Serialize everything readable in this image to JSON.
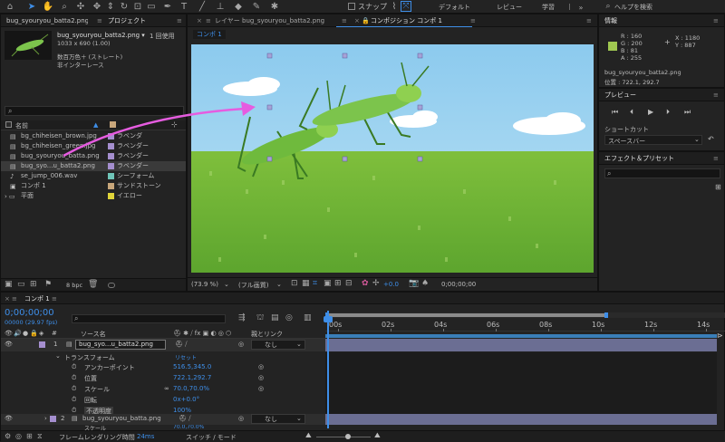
{
  "toolbar": {
    "workspace_link_label": "スナップ",
    "workspaces": [
      "デフォルト",
      "レビュー",
      "学習"
    ],
    "search_placeholder": "ヘルプを検索"
  },
  "project_panel": {
    "left_tab": "bug_syouryou_batta2.png",
    "tab_label": "プロジェクト",
    "preview_name": "bug_syouryou_batta2.png ▾",
    "usage": "1 回使用",
    "dims": "1033 x 690 (1.00)",
    "color_info": "数百万色＋ (ストレート)",
    "interlace": "非インターレース",
    "search_placeholder": "",
    "col_name": "名前",
    "items": [
      {
        "name": "bg_chiheisen_brown.jpg",
        "label": "ラベンダ",
        "color": "#a58fcf"
      },
      {
        "name": "bg_chiheisen_green.jpg",
        "label": "ラベンダー",
        "color": "#a58fcf"
      },
      {
        "name": "bug_syouryou_batta.png",
        "label": "ラベンダー",
        "color": "#a58fcf"
      },
      {
        "name": "bug_syo...u_batta2.png",
        "label": "ラベンダー",
        "color": "#a58fcf"
      },
      {
        "name": "se_jump_006.wav",
        "label": "シーフォーム",
        "color": "#6fc5b8"
      },
      {
        "name": "コンポ 1",
        "label": "サンドストーン",
        "color": "#c8a77b"
      },
      {
        "name": "平面",
        "label": "イエロー",
        "color": "#e0d43a"
      }
    ],
    "bpc": "8 bpc"
  },
  "comp_panel": {
    "layer_tab": "レイヤー bug_syouryou_batta2.png",
    "comp_tab": "コンポジション コンポ 1",
    "sub_tab": "コンポ 1",
    "zoom": "(73.9 %)",
    "quality": "(フル画質)",
    "exposure": "+0.0",
    "timecode": "0;00;00;00"
  },
  "info_panel": {
    "tab_label": "情報",
    "r": "R : 160",
    "g": "G : 200",
    "b": "B : 81",
    "a": "A : 255",
    "x": "X : 1180",
    "y": "Y : 887",
    "color_hex": "#a0c851",
    "name": "bug_syouryou_batta2.png",
    "position": "位置 : 722.1, 292.7"
  },
  "preview_panel": {
    "tab_label": "プレビュー",
    "shortcut_label": "ショートカット",
    "shortcut_value": "スペースバー"
  },
  "effects_panel": {
    "tab_label": "エフェクト＆プリセット",
    "search_placeholder": ""
  },
  "timeline": {
    "tab_label": "コンポ 1",
    "timecode": "0;00;00;00",
    "fps": "00000 (29.97 fps)",
    "col_source": "ソース名",
    "col_parent": "親とリンク",
    "ruler": [
      "00s",
      "02s",
      "04s",
      "06s",
      "08s",
      "10s",
      "12s",
      "14s"
    ],
    "layers": [
      {
        "num": "1",
        "name": "bug_syo...u_batta2.png",
        "parent": "なし"
      },
      {
        "num": "2",
        "name": "bug_syouryou_batta.png",
        "parent": "なし"
      }
    ],
    "transform_label": "トランスフォーム",
    "reset_label": "リセット",
    "props": [
      {
        "name": "アンカーポイント",
        "value": "516.5,345.0"
      },
      {
        "name": "位置",
        "value": "722.1,292.7"
      },
      {
        "name": "スケール",
        "value": "70.0,70.0%"
      },
      {
        "name": "回転",
        "value": "0x+0.0°"
      },
      {
        "name": "不透明度",
        "value": "100%"
      }
    ],
    "layer2_scale": "70.0,70.0%",
    "scale_label": "スケール",
    "render_time_label": "フレームレンダリング時間",
    "render_time": "24ms",
    "switch_mode": "スイッチ / モード"
  }
}
